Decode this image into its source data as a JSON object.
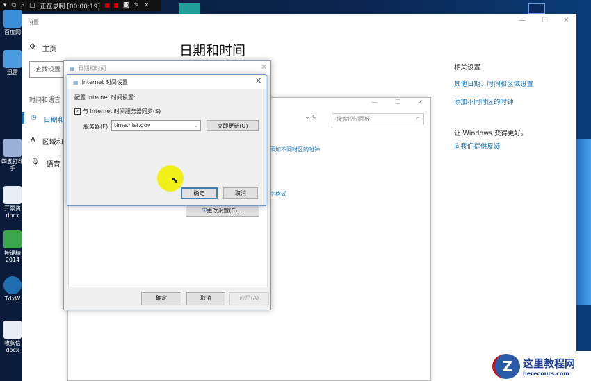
{
  "recorder": {
    "status": "正在录制 [00:00:19]"
  },
  "desktop_icons": [
    "百度网",
    "迅雷",
    "四五打印手",
    "开票资docx",
    "按键精2014",
    "TdxW",
    "收款信docx"
  ],
  "settings": {
    "window_title": "设置",
    "home": "主页",
    "search_placeholder": "查找设置",
    "section": "时间和语言",
    "nav": [
      "日期和",
      "区域和",
      "语音"
    ],
    "page_title": "日期和时间",
    "related_title": "相关设置",
    "related_links": [
      "其他日期、时间和区域设置",
      "添加不同时区的时钟"
    ],
    "improve_title": "让 Windows 变得更好。",
    "feedback_link": "向我们提供反馈"
  },
  "control_panel": {
    "search_placeholder": "搜索控制面板",
    "link_clock": "添加不同时区的时钟",
    "link_format": "字格式"
  },
  "datetime_dialog": {
    "title": "日期和时间",
    "change_settings": "更改设置(C)...",
    "ok": "确定",
    "cancel": "取消",
    "apply": "应用(A)"
  },
  "internet_dialog": {
    "title": "Internet 时间设置",
    "config_label": "配置 Internet 时间设置:",
    "sync_label": "与 Internet 时间服务器同步(S)",
    "sync_checked": true,
    "server_label": "服务器(E):",
    "server_value": "time.nist.gov",
    "update_now": "立即更新(U)",
    "ok": "确定",
    "cancel": "取消"
  },
  "watermark": {
    "name": "这里教程网",
    "url": "herecours.com"
  }
}
